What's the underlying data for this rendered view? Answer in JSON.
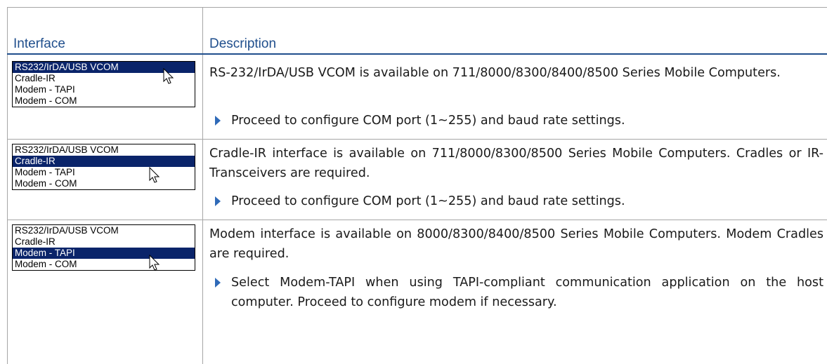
{
  "table": {
    "headers": {
      "interface": "Interface",
      "description": "Description"
    },
    "rows": [
      {
        "list_items": [
          "RS232/IrDA/USB VCOM",
          "Cradle-IR",
          "Modem - TAPI",
          "Modem - COM"
        ],
        "selected_index": 0,
        "description": "RS-232/IrDA/USB VCOM is available on 711/8000/8300/8400/8500 Series Mobile Computers.",
        "bullet": "Proceed to configure COM port (1~255) and baud rate settings."
      },
      {
        "list_items": [
          "RS232/IrDA/USB VCOM",
          "Cradle-IR",
          "Modem - TAPI",
          "Modem - COM"
        ],
        "selected_index": 1,
        "description": "Cradle-IR interface is available on 711/8000/8300/8500 Series Mobile Computers. Cradles or IR-Transceivers are required.",
        "bullet": "Proceed to configure COM port (1~255) and baud rate settings."
      },
      {
        "list_items": [
          "RS232/IrDA/USB VCOM",
          "Cradle-IR",
          "Modem - TAPI",
          "Modem - COM"
        ],
        "selected_index": 2,
        "description": "Modem interface is available on 8000/8300/8400/8500 Series Mobile Computers. Modem Cradles are required.",
        "bullet": "Select Modem-TAPI when using TAPI-compliant communication application on the host computer. Proceed to configure modem if necessary."
      }
    ]
  },
  "colors": {
    "header_text": "#1f4e8c",
    "selection": "#0a246a",
    "bullet": "#2f6ab8",
    "grid": "#a6a6a6"
  }
}
